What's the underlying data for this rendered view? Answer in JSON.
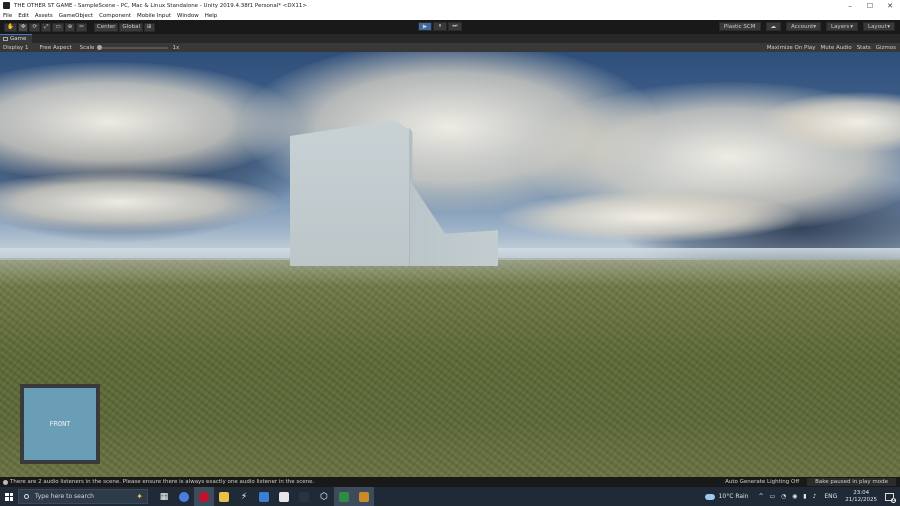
{
  "window": {
    "title": "THE OTHER ST GAME - SampleScene - PC, Mac & Linux Standalone - Unity 2019.4.38f1 Personal* <DX11>",
    "controls": [
      "–",
      "☐",
      "✕"
    ]
  },
  "menu": [
    "File",
    "Edit",
    "Assets",
    "GameObject",
    "Component",
    "Mobile Input",
    "Window",
    "Help"
  ],
  "toolbar": {
    "tools": [
      "✋",
      "✥",
      "⟳",
      "⤢",
      "▭",
      "⊕",
      "✂"
    ],
    "pivot": "Center",
    "space": "Global",
    "play_buttons": [
      "▶",
      "⏸",
      "⏭"
    ],
    "plastic": "Plastic SCM",
    "cloud_icon": "☁",
    "account": "Account",
    "layers": "Layers",
    "layout": "Layout"
  },
  "tab": {
    "label": "Game"
  },
  "gamebar": {
    "display": "Display 1",
    "aspect": "Free Aspect",
    "scale_label": "Scale",
    "scale_value": "1x",
    "maximize": "Maximize On Play",
    "mute": "Mute Audio",
    "stats": "Stats",
    "gizmos": "Gizmos"
  },
  "hud": {
    "label": "FRONT"
  },
  "status": {
    "message": "There are 2 audio listeners in the scene. Please ensure there is always exactly one audio listener in the scene.",
    "lighting": "Auto Generate Lighting Off",
    "bake": "Bake paused in play mode"
  },
  "taskbar": {
    "search_placeholder": "Type here to search",
    "weather": "10°C  Rain",
    "language": "ENG",
    "time": "23:04",
    "date": "21/12/2025",
    "notif_count": "4"
  }
}
